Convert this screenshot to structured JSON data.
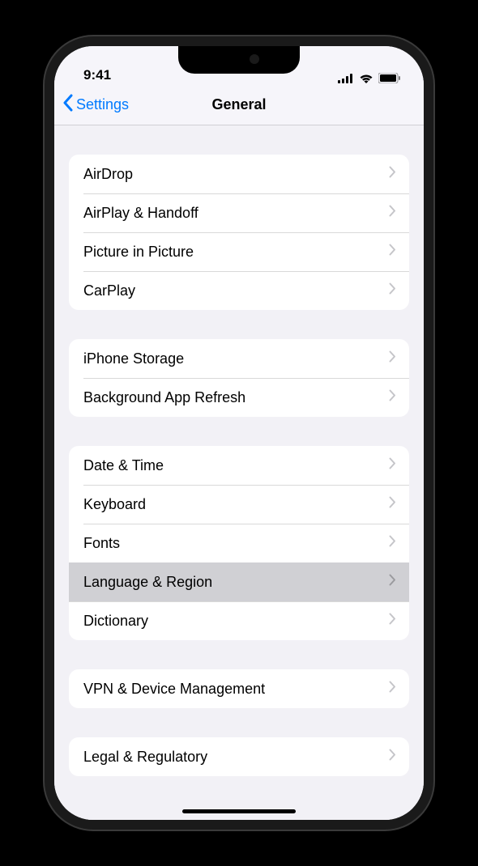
{
  "status": {
    "time": "9:41"
  },
  "nav": {
    "back_label": "Settings",
    "title": "General"
  },
  "groups": [
    {
      "items": [
        {
          "label": "AirDrop",
          "selected": false
        },
        {
          "label": "AirPlay & Handoff",
          "selected": false
        },
        {
          "label": "Picture in Picture",
          "selected": false
        },
        {
          "label": "CarPlay",
          "selected": false
        }
      ]
    },
    {
      "items": [
        {
          "label": "iPhone Storage",
          "selected": false
        },
        {
          "label": "Background App Refresh",
          "selected": false
        }
      ]
    },
    {
      "items": [
        {
          "label": "Date & Time",
          "selected": false
        },
        {
          "label": "Keyboard",
          "selected": false
        },
        {
          "label": "Fonts",
          "selected": false
        },
        {
          "label": "Language & Region",
          "selected": true
        },
        {
          "label": "Dictionary",
          "selected": false
        }
      ]
    },
    {
      "items": [
        {
          "label": "VPN & Device Management",
          "selected": false
        }
      ]
    },
    {
      "items": [
        {
          "label": "Legal & Regulatory",
          "selected": false
        }
      ]
    }
  ]
}
